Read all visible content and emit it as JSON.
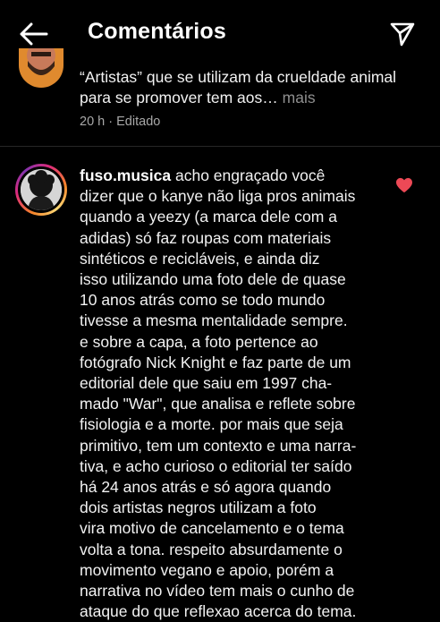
{
  "header": {
    "title": "Comentários",
    "back_icon": "arrow-left-icon",
    "share_icon": "paper-plane-icon"
  },
  "previous_comment": {
    "text": "“Artistas” que se utilizam da crueldade animal para se promover tem aos…",
    "more_label": "mais",
    "time": "20 h",
    "separator": "·",
    "edited_label": "Editado"
  },
  "comment": {
    "username": "fuso.musica",
    "text": "acho engraçado você\ndizer que o kanye não liga pros animais\nquando a yeezy (a marca dele com a\nadidas) só faz roupas com materiais\nsintéticos e recicláveis, e ainda diz\nisso utilizando uma foto dele de quase\n10 anos atrás como se todo mundo\ntivesse a mesma mentalidade sempre.\ne sobre a capa, a foto pertence ao\nfotógrafo Nick Knight e faz parte de um\neditorial dele que saiu em 1997 cha-\nmado \"War\", que analisa e reflete sobre\nfisiologia e a morte. por mais que seja\nprimitivo, tem um contexto e uma narra-\ntiva, e acho curioso o editorial ter saído\nhá 24 anos atrás e só agora quando\ndois artistas negros utilizam a foto\nvira motivo de cancelamento e o tema\nvolta a tona. respeito absurdamente o\nmovimento vegano e apoio, porém a\nnarrativa no vídeo tem mais o cunho de\nataque do que reflexao acerca do tema.",
    "liked": true,
    "like_icon": "heart-filled-icon"
  },
  "colors": {
    "background": "#000000",
    "text": "#f2f2f2",
    "secondary_text": "#a8a8a8",
    "like_red": "#ed4956",
    "divider": "#262626"
  }
}
